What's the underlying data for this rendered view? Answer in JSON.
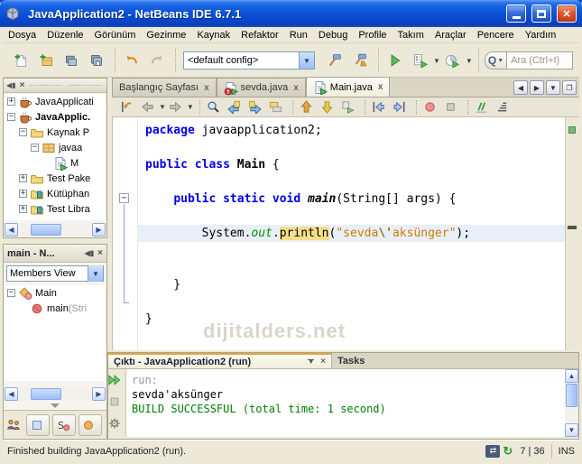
{
  "window": {
    "title": "JavaApplication2 - NetBeans IDE 6.7.1",
    "controls": [
      "minimize",
      "maximize",
      "close"
    ]
  },
  "menubar": {
    "items": [
      "Dosya",
      "Düzenle",
      "Görünüm",
      "Gezinme",
      "Kaynak",
      "Refaktor",
      "Run",
      "Debug",
      "Profile",
      "Takım",
      "Araçlar",
      "Pencere",
      "Yardım"
    ]
  },
  "toolbar": {
    "groups_before_config": [
      [
        "new-file-icon",
        "new-project-icon",
        "open-project-icon",
        "save-all-icon"
      ],
      [
        "undo-icon",
        "redo-icon"
      ]
    ],
    "config_value": "<default config>",
    "groups_after_config": [
      [
        "build-icon",
        "clean-build-icon"
      ],
      [
        "run-icon",
        "debug-icon",
        "profile-icon"
      ]
    ],
    "dropdown_icons": [
      "debug-icon",
      "profile-icon"
    ],
    "search_placeholder": "Ara (Ctrl+I)"
  },
  "projects_panel": {
    "tree": [
      {
        "depth": 0,
        "expander": "plus",
        "icon": "project-icon",
        "label": "JavaApplicati",
        "bold": false
      },
      {
        "depth": 0,
        "expander": "minus",
        "icon": "project-icon",
        "label": "JavaApplic.",
        "bold": true
      },
      {
        "depth": 1,
        "expander": "minus",
        "icon": "folder-icon",
        "label": "Kaynak P",
        "bold": false
      },
      {
        "depth": 2,
        "expander": "minus",
        "icon": "package-icon",
        "label": "javaa",
        "bold": false
      },
      {
        "depth": 3,
        "expander": "none",
        "icon": "java-main-icon",
        "label": "M",
        "bold": false
      },
      {
        "depth": 1,
        "expander": "plus",
        "icon": "folder-icon",
        "label": "Test Pake",
        "bold": false
      },
      {
        "depth": 1,
        "expander": "plus",
        "icon": "library-icon",
        "label": "Kütüphan",
        "bold": false
      },
      {
        "depth": 1,
        "expander": "plus",
        "icon": "library-icon",
        "label": "Test Libra",
        "bold": false
      }
    ]
  },
  "navigator_panel": {
    "title": "main - N...",
    "view_value": "Members View",
    "tree": [
      {
        "depth": 0,
        "expander": "minus",
        "icon": "class-icon",
        "label": "Main",
        "suffix": "",
        "bold": false
      },
      {
        "depth": 1,
        "expander": "none",
        "icon": "method-icon",
        "label": "main",
        "suffix": "(Stri",
        "bold": false
      }
    ],
    "filters": [
      "inherited-members-icon",
      "show-fields-icon",
      "show-static-icon",
      "show-public-icon"
    ]
  },
  "editor": {
    "tabs": [
      {
        "label": "Başlangıç Sayfası",
        "icon": null,
        "active": false
      },
      {
        "label": "sevda.java",
        "icon": "java-error-icon",
        "active": false
      },
      {
        "label": "Main.java",
        "icon": "java-main-icon",
        "active": true
      }
    ],
    "toolbar_groups": [
      [
        "last-edit-icon",
        "back-icon",
        "forward-icon"
      ],
      [
        "find-selection-icon",
        "find-prev-icon",
        "find-next-icon",
        "highlight-icon"
      ],
      [
        "prev-occurrence-icon",
        "next-occurrence-icon",
        "toggle-highlight-icon"
      ],
      [
        "shift-left-icon",
        "shift-right-icon"
      ],
      [
        "record-macro-icon",
        "stop-macro-icon"
      ],
      [
        "comment-icon",
        "uncomment-icon"
      ]
    ],
    "toolbar_dropdown_icons": [
      "back-icon",
      "forward-icon"
    ],
    "code_lines": [
      {
        "tokens": [
          {
            "c": "kw",
            "t": "package"
          },
          {
            "c": "pl",
            "t": " javaapplication2;"
          }
        ]
      },
      {
        "tokens": []
      },
      {
        "tokens": [
          {
            "c": "kw",
            "t": "public"
          },
          {
            "c": "pl",
            "t": " "
          },
          {
            "c": "kw",
            "t": "class"
          },
          {
            "c": "pl",
            "t": " "
          },
          {
            "c": "cls",
            "t": "Main"
          },
          {
            "c": "pl",
            "t": " {"
          }
        ]
      },
      {
        "tokens": []
      },
      {
        "fold": true,
        "tokens": [
          {
            "c": "pl",
            "t": "    "
          },
          {
            "c": "kw",
            "t": "public"
          },
          {
            "c": "pl",
            "t": " "
          },
          {
            "c": "kw",
            "t": "static"
          },
          {
            "c": "pl",
            "t": " "
          },
          {
            "c": "kw",
            "t": "void"
          },
          {
            "c": "pl",
            "t": " "
          },
          {
            "c": "mth",
            "t": "main"
          },
          {
            "c": "pl",
            "t": "(String[] args) {"
          }
        ]
      },
      {
        "tokens": []
      },
      {
        "highlight": true,
        "tokens": [
          {
            "c": "pl",
            "t": "        System."
          },
          {
            "c": "fld",
            "t": "out"
          },
          {
            "c": "pl",
            "t": "."
          },
          {
            "c": "occ",
            "t": "println"
          },
          {
            "c": "pl",
            "t": "("
          },
          {
            "c": "str",
            "t": "\"sevda"
          },
          {
            "c": "esc",
            "t": "\\'"
          },
          {
            "c": "str",
            "t": "aksünger\""
          },
          {
            "c": "pl",
            "t": ");"
          }
        ]
      },
      {
        "tokens": []
      },
      {
        "tokens": []
      },
      {
        "tokens": [
          {
            "c": "pl",
            "t": "    }"
          }
        ]
      },
      {
        "tokens": []
      },
      {
        "tokens": [
          {
            "c": "pl",
            "t": "}"
          }
        ]
      }
    ],
    "watermark": "dijitalders.net"
  },
  "output_panel": {
    "active_tab": "Çıktı - JavaApplication2 (run)",
    "second_tab": "Tasks",
    "side_icons": [
      "rerun-icon",
      "stop-icon",
      "settings-icon"
    ],
    "lines": [
      {
        "kind": "info",
        "text": "run:"
      },
      {
        "kind": "plain",
        "text": "sevda'aksünger"
      },
      {
        "kind": "success",
        "text": "BUILD SUCCESSFUL (total time: 1 second)"
      }
    ]
  },
  "statusbar": {
    "message": "Finished building JavaApplication2 (run).",
    "caret_position": "7 | 36",
    "mode": "INS"
  },
  "colors": {
    "keyword": "#0000e6",
    "string": "#ce7b00",
    "field": "#009300",
    "escape": "#8a7000",
    "build_success": "#008000",
    "occurrence_highlight": "#f3e08c",
    "current_line": "#e9eff9",
    "output_tab_accent": "#e8a33d",
    "titlebar_blue": "#0c52d8"
  }
}
